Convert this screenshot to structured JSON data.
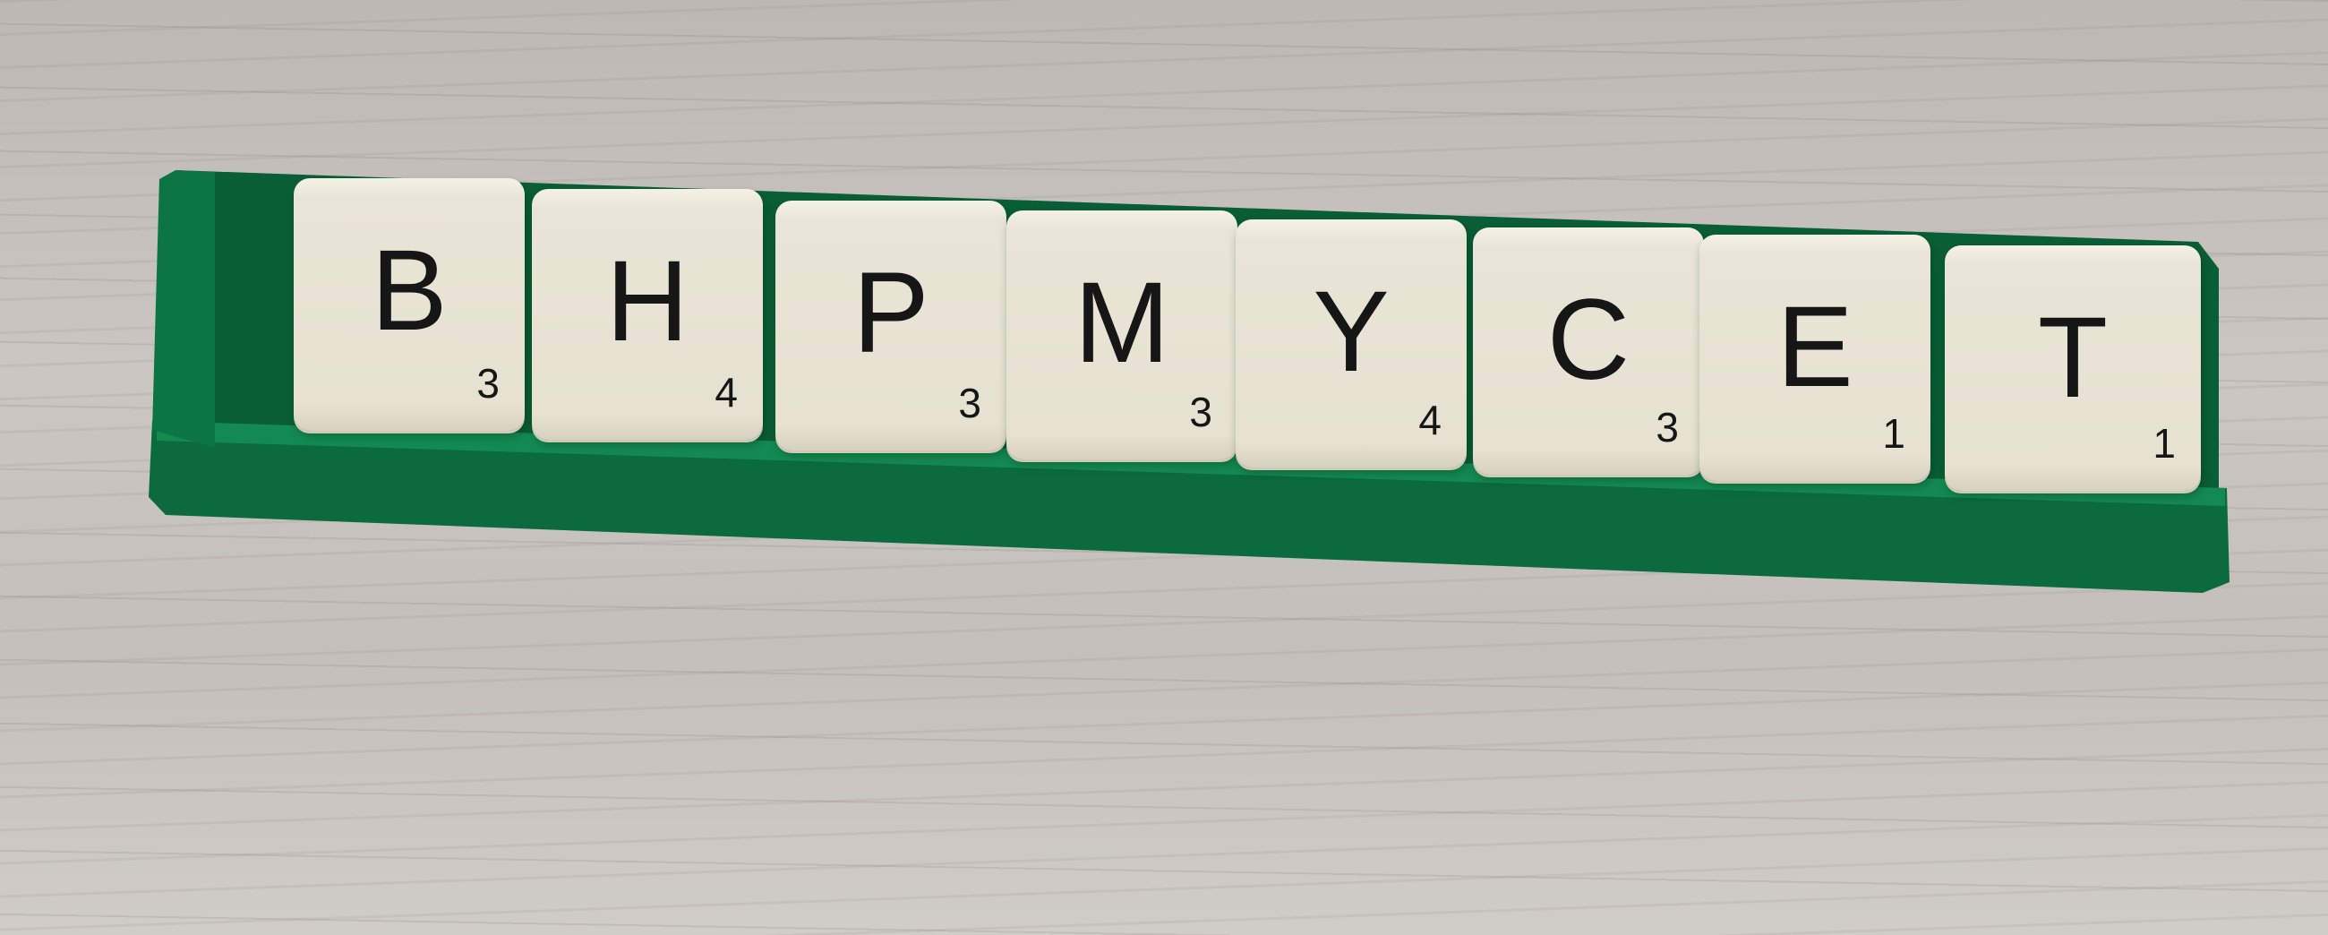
{
  "colors": {
    "rack": "#0b6b3e",
    "rack_highlight": "#148a53",
    "tile": "#e8e4d4",
    "wood": "#c8c3bf"
  },
  "tiles": [
    {
      "letter": "B",
      "points": "3"
    },
    {
      "letter": "H",
      "points": "4"
    },
    {
      "letter": "P",
      "points": "3"
    },
    {
      "letter": "M",
      "points": "3"
    },
    {
      "letter": "Y",
      "points": "4"
    },
    {
      "letter": "C",
      "points": "3"
    },
    {
      "letter": "E",
      "points": "1"
    },
    {
      "letter": "T",
      "points": "1"
    }
  ]
}
